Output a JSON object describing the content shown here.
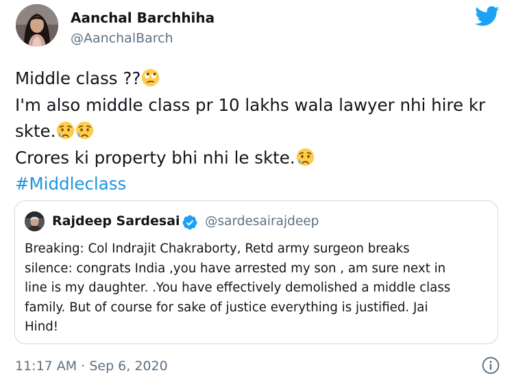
{
  "author": {
    "name": "Aanchal Barchhiha",
    "handle": "@AanchalBarch"
  },
  "brand": {
    "icon": "twitter-bird-icon",
    "color": "#1da1f2"
  },
  "tweet": {
    "line1_text": "Middle class ??",
    "line1_emoji": "face-with-rolling-eyes-emoji",
    "line2_text": "I'm also middle class pr 10 lakhs wala lawyer nhi hire kr",
    "line3_text": "skte.",
    "line3_emojis": [
      "crying-face-emoji",
      "crying-face-emoji"
    ],
    "line4_text": "Crores ki property bhi nhi le skte.",
    "line4_emoji": "crying-face-emoji",
    "hashtag": "#Middleclass",
    "hashtag_color": "#1b95e0"
  },
  "quoted_tweet": {
    "name": "Rajdeep Sardesai",
    "verified": true,
    "handle": "@sardesairajdeep",
    "text": "Breaking: Col Indrajit Chakraborty, Retd army surgeon breaks\nsilence: congrats India ,you have arrested my son , am sure next in\nline is my daughter. .You have effectively demolished a middle class\nfamily. But of course for sake of justice everything is justified. Jai\nHind!"
  },
  "meta": {
    "time": "11:17 AM",
    "separator": "·",
    "date": "Sep 6, 2020",
    "info_icon": "info-icon"
  }
}
